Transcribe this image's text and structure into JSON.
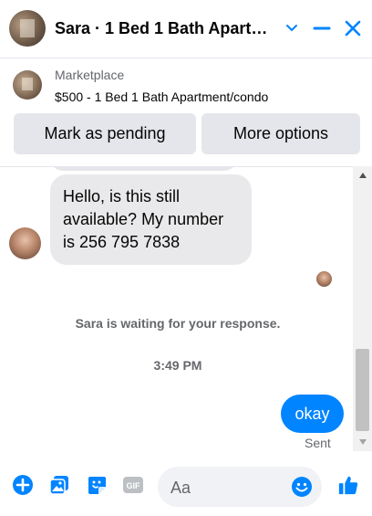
{
  "header": {
    "title": "Sara · 1 Bed 1 Bath Apartm...",
    "icons": [
      "chevron-down-icon",
      "minimize-icon",
      "close-icon"
    ],
    "accent": "#0084ff"
  },
  "marketplace": {
    "label": "Marketplace",
    "listing": "$500 - 1 Bed 1 Bath Apartment/condo",
    "buttons": {
      "pending": "Mark as pending",
      "more": "More options"
    }
  },
  "chat": {
    "incoming_message": "Hello, is this still available? My number is 256 795 7838",
    "waiting_note": "Sara is waiting for your response.",
    "timestamp": "3:49 PM",
    "outgoing_message": "okay",
    "status": "Sent"
  },
  "composer": {
    "placeholder": "Aa",
    "icons": [
      "add-icon",
      "photo-icon",
      "sticker-icon",
      "gif-icon",
      "emoji-icon",
      "like-icon"
    ]
  }
}
